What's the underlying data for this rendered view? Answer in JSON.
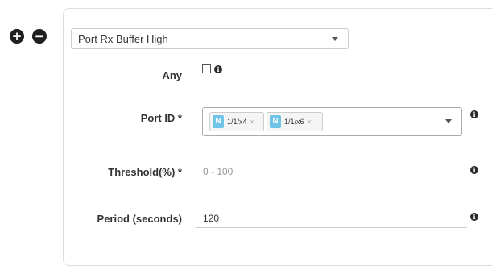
{
  "controls": {
    "add_icon": "plus-circle-icon",
    "remove_icon": "minus-circle-icon"
  },
  "rule": {
    "selected": "Port Rx Buffer High"
  },
  "fields": {
    "any": {
      "label": "Any",
      "checked": false
    },
    "port_id": {
      "label": "Port ID *",
      "tags": [
        {
          "badge": "N",
          "text": "1/1/x4",
          "remove": "×"
        },
        {
          "badge": "N",
          "text": "1/1/x6",
          "remove": "×"
        }
      ]
    },
    "threshold": {
      "label": "Threshold(%) *",
      "value": "",
      "placeholder": "0 - 100"
    },
    "period": {
      "label": "Period (seconds)",
      "value": "120",
      "placeholder": ""
    }
  },
  "info_icon_glyph": "i",
  "colors": {
    "tag_badge": "#6fc4e6",
    "icon": "#1f1f1f"
  }
}
